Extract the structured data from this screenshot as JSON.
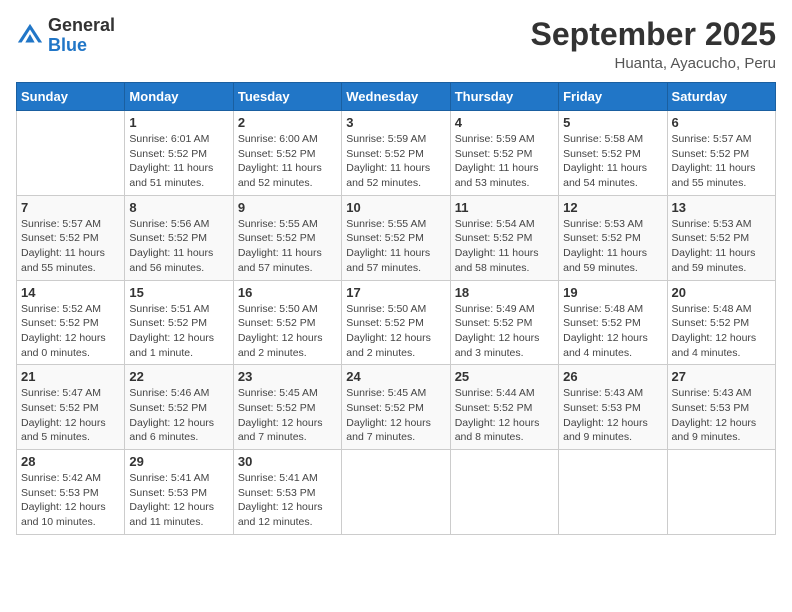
{
  "header": {
    "logo_general": "General",
    "logo_blue": "Blue",
    "month_year": "September 2025",
    "location": "Huanta, Ayacucho, Peru"
  },
  "days_of_week": [
    "Sunday",
    "Monday",
    "Tuesday",
    "Wednesday",
    "Thursday",
    "Friday",
    "Saturday"
  ],
  "weeks": [
    [
      {
        "day": "",
        "info": ""
      },
      {
        "day": "1",
        "info": "Sunrise: 6:01 AM\nSunset: 5:52 PM\nDaylight: 11 hours and 51 minutes."
      },
      {
        "day": "2",
        "info": "Sunrise: 6:00 AM\nSunset: 5:52 PM\nDaylight: 11 hours and 52 minutes."
      },
      {
        "day": "3",
        "info": "Sunrise: 5:59 AM\nSunset: 5:52 PM\nDaylight: 11 hours and 52 minutes."
      },
      {
        "day": "4",
        "info": "Sunrise: 5:59 AM\nSunset: 5:52 PM\nDaylight: 11 hours and 53 minutes."
      },
      {
        "day": "5",
        "info": "Sunrise: 5:58 AM\nSunset: 5:52 PM\nDaylight: 11 hours and 54 minutes."
      },
      {
        "day": "6",
        "info": "Sunrise: 5:57 AM\nSunset: 5:52 PM\nDaylight: 11 hours and 55 minutes."
      }
    ],
    [
      {
        "day": "7",
        "info": "Sunrise: 5:57 AM\nSunset: 5:52 PM\nDaylight: 11 hours and 55 minutes."
      },
      {
        "day": "8",
        "info": "Sunrise: 5:56 AM\nSunset: 5:52 PM\nDaylight: 11 hours and 56 minutes."
      },
      {
        "day": "9",
        "info": "Sunrise: 5:55 AM\nSunset: 5:52 PM\nDaylight: 11 hours and 57 minutes."
      },
      {
        "day": "10",
        "info": "Sunrise: 5:55 AM\nSunset: 5:52 PM\nDaylight: 11 hours and 57 minutes."
      },
      {
        "day": "11",
        "info": "Sunrise: 5:54 AM\nSunset: 5:52 PM\nDaylight: 11 hours and 58 minutes."
      },
      {
        "day": "12",
        "info": "Sunrise: 5:53 AM\nSunset: 5:52 PM\nDaylight: 11 hours and 59 minutes."
      },
      {
        "day": "13",
        "info": "Sunrise: 5:53 AM\nSunset: 5:52 PM\nDaylight: 11 hours and 59 minutes."
      }
    ],
    [
      {
        "day": "14",
        "info": "Sunrise: 5:52 AM\nSunset: 5:52 PM\nDaylight: 12 hours and 0 minutes."
      },
      {
        "day": "15",
        "info": "Sunrise: 5:51 AM\nSunset: 5:52 PM\nDaylight: 12 hours and 1 minute."
      },
      {
        "day": "16",
        "info": "Sunrise: 5:50 AM\nSunset: 5:52 PM\nDaylight: 12 hours and 2 minutes."
      },
      {
        "day": "17",
        "info": "Sunrise: 5:50 AM\nSunset: 5:52 PM\nDaylight: 12 hours and 2 minutes."
      },
      {
        "day": "18",
        "info": "Sunrise: 5:49 AM\nSunset: 5:52 PM\nDaylight: 12 hours and 3 minutes."
      },
      {
        "day": "19",
        "info": "Sunrise: 5:48 AM\nSunset: 5:52 PM\nDaylight: 12 hours and 4 minutes."
      },
      {
        "day": "20",
        "info": "Sunrise: 5:48 AM\nSunset: 5:52 PM\nDaylight: 12 hours and 4 minutes."
      }
    ],
    [
      {
        "day": "21",
        "info": "Sunrise: 5:47 AM\nSunset: 5:52 PM\nDaylight: 12 hours and 5 minutes."
      },
      {
        "day": "22",
        "info": "Sunrise: 5:46 AM\nSunset: 5:52 PM\nDaylight: 12 hours and 6 minutes."
      },
      {
        "day": "23",
        "info": "Sunrise: 5:45 AM\nSunset: 5:52 PM\nDaylight: 12 hours and 7 minutes."
      },
      {
        "day": "24",
        "info": "Sunrise: 5:45 AM\nSunset: 5:52 PM\nDaylight: 12 hours and 7 minutes."
      },
      {
        "day": "25",
        "info": "Sunrise: 5:44 AM\nSunset: 5:52 PM\nDaylight: 12 hours and 8 minutes."
      },
      {
        "day": "26",
        "info": "Sunrise: 5:43 AM\nSunset: 5:53 PM\nDaylight: 12 hours and 9 minutes."
      },
      {
        "day": "27",
        "info": "Sunrise: 5:43 AM\nSunset: 5:53 PM\nDaylight: 12 hours and 9 minutes."
      }
    ],
    [
      {
        "day": "28",
        "info": "Sunrise: 5:42 AM\nSunset: 5:53 PM\nDaylight: 12 hours and 10 minutes."
      },
      {
        "day": "29",
        "info": "Sunrise: 5:41 AM\nSunset: 5:53 PM\nDaylight: 12 hours and 11 minutes."
      },
      {
        "day": "30",
        "info": "Sunrise: 5:41 AM\nSunset: 5:53 PM\nDaylight: 12 hours and 12 minutes."
      },
      {
        "day": "",
        "info": ""
      },
      {
        "day": "",
        "info": ""
      },
      {
        "day": "",
        "info": ""
      },
      {
        "day": "",
        "info": ""
      }
    ]
  ]
}
